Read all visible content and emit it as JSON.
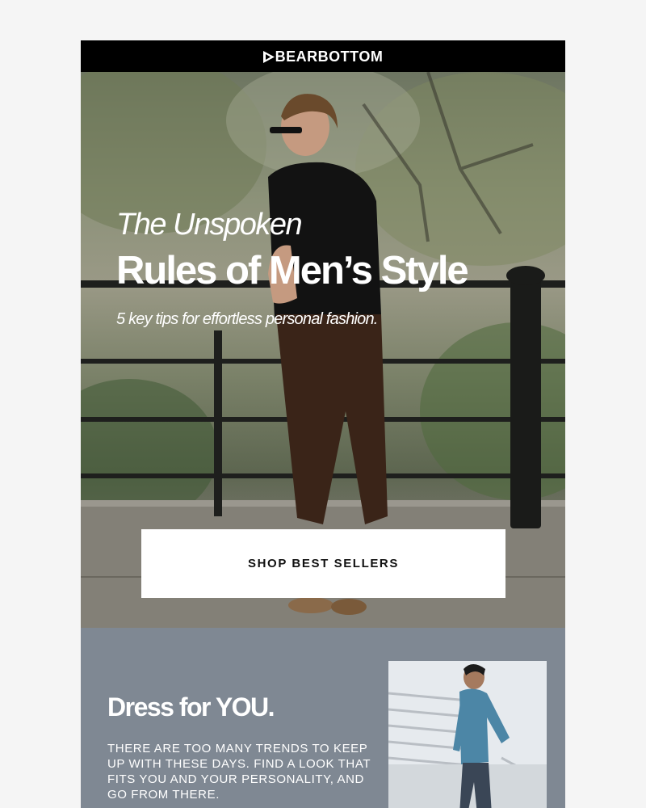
{
  "brand": {
    "name": "BEARBOTTOM"
  },
  "hero": {
    "kicker": "The Unspoken",
    "title": "Rules of Men’s Style",
    "subtitle": "5 key tips for effortless personal fashion.",
    "cta_label": "SHOP BEST SELLERS",
    "image_icon": "man-leaning-on-railing-photo"
  },
  "section2": {
    "title": "Dress for YOU.",
    "body": "There are too many trends to keep up with these days. Find a look that fits you and your personality, and go from there.",
    "image_icon": "man-walking-up-stairs-photo"
  },
  "colors": {
    "topbar": "#000000",
    "section2_bg": "#7f8893",
    "page_bg": "#f5f5f5",
    "button_bg": "#ffffff"
  }
}
